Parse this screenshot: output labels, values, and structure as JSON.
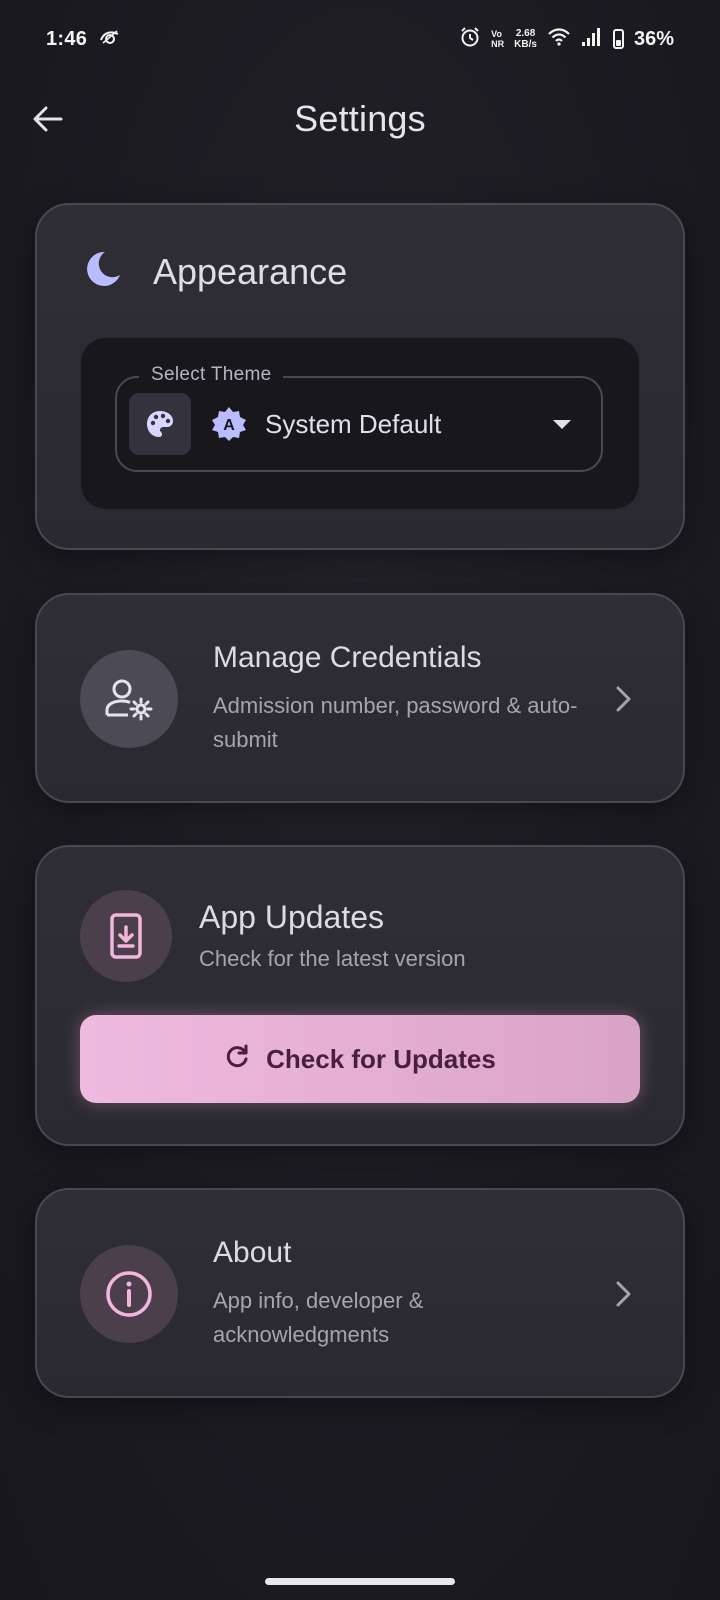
{
  "status_bar": {
    "time": "1:46",
    "volte_top": "Vo",
    "volte_bottom": "NR",
    "net_speed_value": "2.68",
    "net_speed_unit": "KB/s",
    "battery": "36%"
  },
  "header": {
    "title": "Settings"
  },
  "appearance": {
    "title": "Appearance",
    "theme_label": "Select Theme",
    "theme_value": "System Default",
    "auto_icon_letter": "A"
  },
  "credentials": {
    "title": "Manage Credentials",
    "subtitle": "Admission number, password & auto-submit"
  },
  "updates": {
    "title": "App Updates",
    "subtitle": "Check for the latest version",
    "button_label": "Check for Updates"
  },
  "about": {
    "title": "About",
    "subtitle": "App info, developer & acknowledgments"
  },
  "colors": {
    "accent_lavender": "#b9bcff",
    "accent_pink": "#efbadf",
    "button_text": "#4a1f3e",
    "background": "#1b1b20"
  }
}
